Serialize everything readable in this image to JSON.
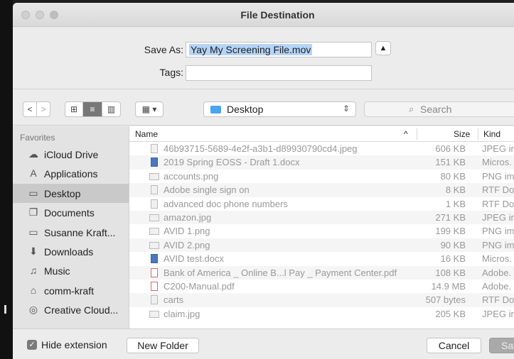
{
  "window": {
    "title": "File Destination"
  },
  "save_form": {
    "save_as_label": "Save As:",
    "filename": "Yay My Screening File.mov",
    "tags_label": "Tags:",
    "tags_value": ""
  },
  "toolbar": {
    "back": "<",
    "forward": ">",
    "location": "Desktop",
    "search_placeholder": "Search"
  },
  "sidebar": {
    "heading": "Favorites",
    "items": [
      {
        "label": "iCloud Drive",
        "icon": "cloud-icon",
        "glyph": "☁"
      },
      {
        "label": "Applications",
        "icon": "applications-icon",
        "glyph": "A"
      },
      {
        "label": "Desktop",
        "icon": "desktop-icon",
        "glyph": "▭",
        "selected": true
      },
      {
        "label": "Documents",
        "icon": "documents-icon",
        "glyph": "❐"
      },
      {
        "label": "Susanne Kraft...",
        "icon": "home-folder-icon",
        "glyph": "▭"
      },
      {
        "label": "Downloads",
        "icon": "downloads-icon",
        "glyph": "⬇"
      },
      {
        "label": "Music",
        "icon": "music-icon",
        "glyph": "♫"
      },
      {
        "label": "comm-kraft",
        "icon": "house-icon",
        "glyph": "⌂"
      },
      {
        "label": "Creative Cloud...",
        "icon": "creative-cloud-icon",
        "glyph": "◎"
      }
    ]
  },
  "columns": {
    "name": "Name",
    "size": "Size",
    "kind": "Kind",
    "sort_indicator": "^"
  },
  "files": [
    {
      "name": "46b93715-5689-4e2f-a3b1-d89930790cd4.jpeg",
      "size": "606 KB",
      "kind": "JPEG in"
    },
    {
      "name": "2019 Spring EOSS - Draft 1.docx",
      "size": "151 KB",
      "kind": "Micros."
    },
    {
      "name": "accounts.png",
      "size": "80 KB",
      "kind": "PNG im"
    },
    {
      "name": "Adobe single sign on",
      "size": "8 KB",
      "kind": "RTF Do"
    },
    {
      "name": "advanced doc phone numbers",
      "size": "1 KB",
      "kind": "RTF Do"
    },
    {
      "name": "amazon.jpg",
      "size": "271 KB",
      "kind": "JPEG in"
    },
    {
      "name": "AVID 1.png",
      "size": "199 KB",
      "kind": "PNG im"
    },
    {
      "name": "AVID 2.png",
      "size": "90 KB",
      "kind": "PNG im"
    },
    {
      "name": "AVID test.docx",
      "size": "16 KB",
      "kind": "Micros."
    },
    {
      "name": "Bank of America _ Online B...l Pay _ Payment Center.pdf",
      "size": "108 KB",
      "kind": "Adobe."
    },
    {
      "name": "C200-Manual.pdf",
      "size": "14.9 MB",
      "kind": "Adobe."
    },
    {
      "name": "carts",
      "size": "507 bytes",
      "kind": "RTF Do"
    },
    {
      "name": "claim.jpg",
      "size": "205 KB",
      "kind": "JPEG in"
    }
  ],
  "footer": {
    "hide_extension_label": "Hide extension",
    "hide_extension_checked": true,
    "new_folder": "New Folder",
    "cancel": "Cancel",
    "save": "Sav"
  }
}
